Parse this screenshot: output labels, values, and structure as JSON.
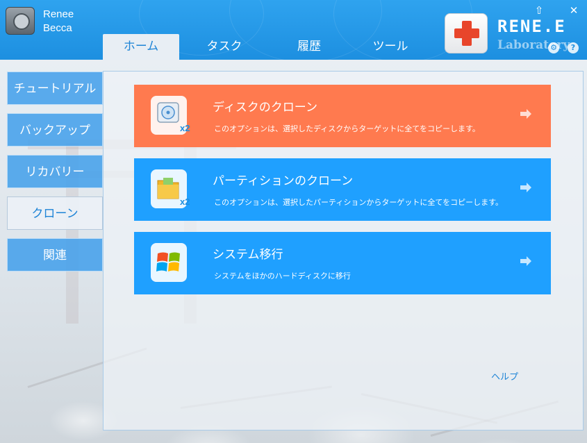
{
  "app": {
    "name": "Renee\nBecca"
  },
  "brand": {
    "name": "RENE.E",
    "subtitle": "Laboratory"
  },
  "window_controls": {
    "minimize": "⇧",
    "close": "✕",
    "settings": "⚙",
    "help": "?"
  },
  "tabs": [
    {
      "label": "ホーム",
      "active": true
    },
    {
      "label": "タスク",
      "active": false
    },
    {
      "label": "履歴",
      "active": false
    },
    {
      "label": "ツール",
      "active": false
    }
  ],
  "sidebar": {
    "items": [
      {
        "label": "チュートリアル",
        "active": false
      },
      {
        "label": "バックアップ",
        "active": false
      },
      {
        "label": "リカバリー",
        "active": false
      },
      {
        "label": "クローン",
        "active": true
      },
      {
        "label": "関連",
        "active": false
      }
    ]
  },
  "cards": [
    {
      "title": "ディスクのクローン",
      "description": "このオプションは、選択したディスクからターゲットに全てをコピーします。",
      "badge": "x2",
      "icon": "disk-clone-icon",
      "color": "#ff7a4f"
    },
    {
      "title": "パーティションのクローン",
      "description": "このオプションは、選択したパーティションからターゲットに全てをコピーします。",
      "badge": "x2",
      "icon": "partition-clone-icon",
      "color": "#1fa0ff"
    },
    {
      "title": "システム移行",
      "description": "システムをほかのハードディスクに移行",
      "icon": "windows-icon",
      "color": "#1fa0ff"
    }
  ],
  "help": {
    "label": "ヘルプ"
  },
  "colors": {
    "header": "#1d8fe0",
    "accent": "#1e84d6",
    "orange_card": "#ff7a4f",
    "blue_card": "#1fa0ff"
  }
}
